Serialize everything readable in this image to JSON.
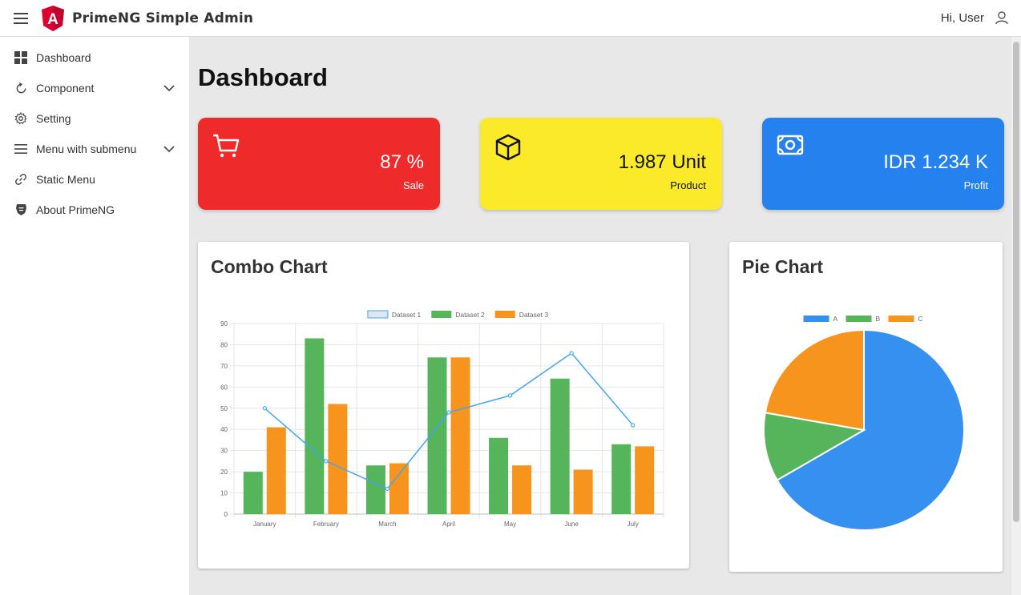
{
  "header": {
    "app_title": "PrimeNG Simple Admin",
    "greeting": "Hi, User",
    "logo_letter": "A"
  },
  "sidebar": {
    "items": [
      {
        "label": "Dashboard",
        "icon": "grid-icon"
      },
      {
        "label": "Component",
        "icon": "refresh-icon",
        "expandable": true
      },
      {
        "label": "Setting",
        "icon": "gear-icon"
      },
      {
        "label": "Menu with submenu",
        "icon": "menu-icon",
        "expandable": true
      },
      {
        "label": "Static Menu",
        "icon": "link-icon"
      },
      {
        "label": "About PrimeNG",
        "icon": "primeng-icon"
      }
    ]
  },
  "main": {
    "title": "Dashboard",
    "stats": [
      {
        "value": "87 %",
        "label": "Sale",
        "icon": "cart-icon",
        "color": "#ef2a2a"
      },
      {
        "value": "1.987 Unit",
        "label": "Product",
        "icon": "box-icon",
        "color": "#fbea2a"
      },
      {
        "value": "IDR 1.234 K",
        "label": "Profit",
        "icon": "money-icon",
        "color": "#2581ee"
      }
    ],
    "combo_title": "Combo Chart",
    "pie_title": "Pie Chart"
  },
  "chart_data": [
    {
      "type": "bar",
      "title": "Combo Chart",
      "categories": [
        "January",
        "February",
        "March",
        "April",
        "May",
        "June",
        "July"
      ],
      "ylim": [
        0,
        90
      ],
      "yticks": [
        0,
        10,
        20,
        30,
        40,
        50,
        60,
        70,
        80,
        90
      ],
      "grid": true,
      "legend": "top",
      "series": [
        {
          "name": "Dataset 1",
          "type": "line",
          "color": "#42A5F5",
          "values": [
            50,
            25,
            12,
            48,
            56,
            76,
            42
          ]
        },
        {
          "name": "Dataset 2",
          "type": "bar",
          "color": "#56b45b",
          "values": [
            20,
            83,
            23,
            74,
            36,
            64,
            33
          ]
        },
        {
          "name": "Dataset 3",
          "type": "bar",
          "color": "#f7941d",
          "values": [
            41,
            52,
            24,
            74,
            23,
            21,
            32
          ]
        }
      ]
    },
    {
      "type": "pie",
      "title": "Pie Chart",
      "legend": "top",
      "labels": [
        "A",
        "B",
        "C"
      ],
      "values": [
        300,
        50,
        100
      ],
      "colors": [
        "#3690f0",
        "#56b45b",
        "#f7941d"
      ]
    }
  ]
}
